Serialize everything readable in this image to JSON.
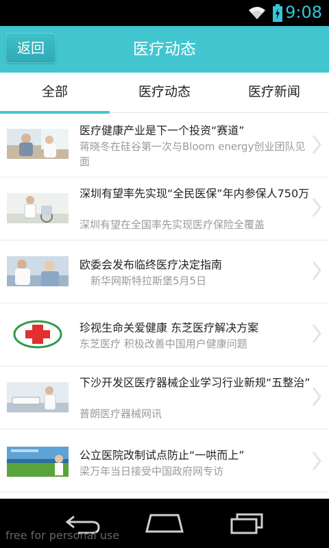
{
  "statusbar": {
    "time": "9:08"
  },
  "header": {
    "back_label": "返回",
    "title": "医疗动态"
  },
  "tabs": [
    {
      "label": "全部",
      "selected": true
    },
    {
      "label": "医疗动态",
      "selected": false
    },
    {
      "label": "医疗新闻",
      "selected": false
    }
  ],
  "items": [
    {
      "title": "医疗健康产业是下一个投资“赛道”",
      "subtitle": "蒋晓冬在硅谷第一次与Bloom energy创业团队见面"
    },
    {
      "title": "深圳有望率先实现“全民医保”年内参保人750万",
      "subtitle": "深圳有望在全国率先实现医疗保险全覆盖"
    },
    {
      "title": "欧委会发布临终医疗决定指南",
      "subtitle": "新华网斯特拉斯堡5月5日"
    },
    {
      "title": "珍视生命关爱健康 东芝医疗解决方案",
      "subtitle": "东芝医疗 积极改善中国用户健康问题"
    },
    {
      "title": "下沙开发区医疗器械企业学习行业新规“五整治”",
      "subtitle": "普朗医疗器械网讯"
    },
    {
      "title": "公立医院改制试点防止“一哄而上”",
      "subtitle": "梁万年当日接受中国政府网专访"
    }
  ],
  "watermark": "free for personal use",
  "colors": {
    "accent": "#41c6d0",
    "status_icons": "#33c7d7"
  },
  "icons": [
    "wifi-icon",
    "battery-icon",
    "chevron-right-icon",
    "nav-back-icon",
    "nav-home-icon",
    "nav-recents-icon"
  ]
}
